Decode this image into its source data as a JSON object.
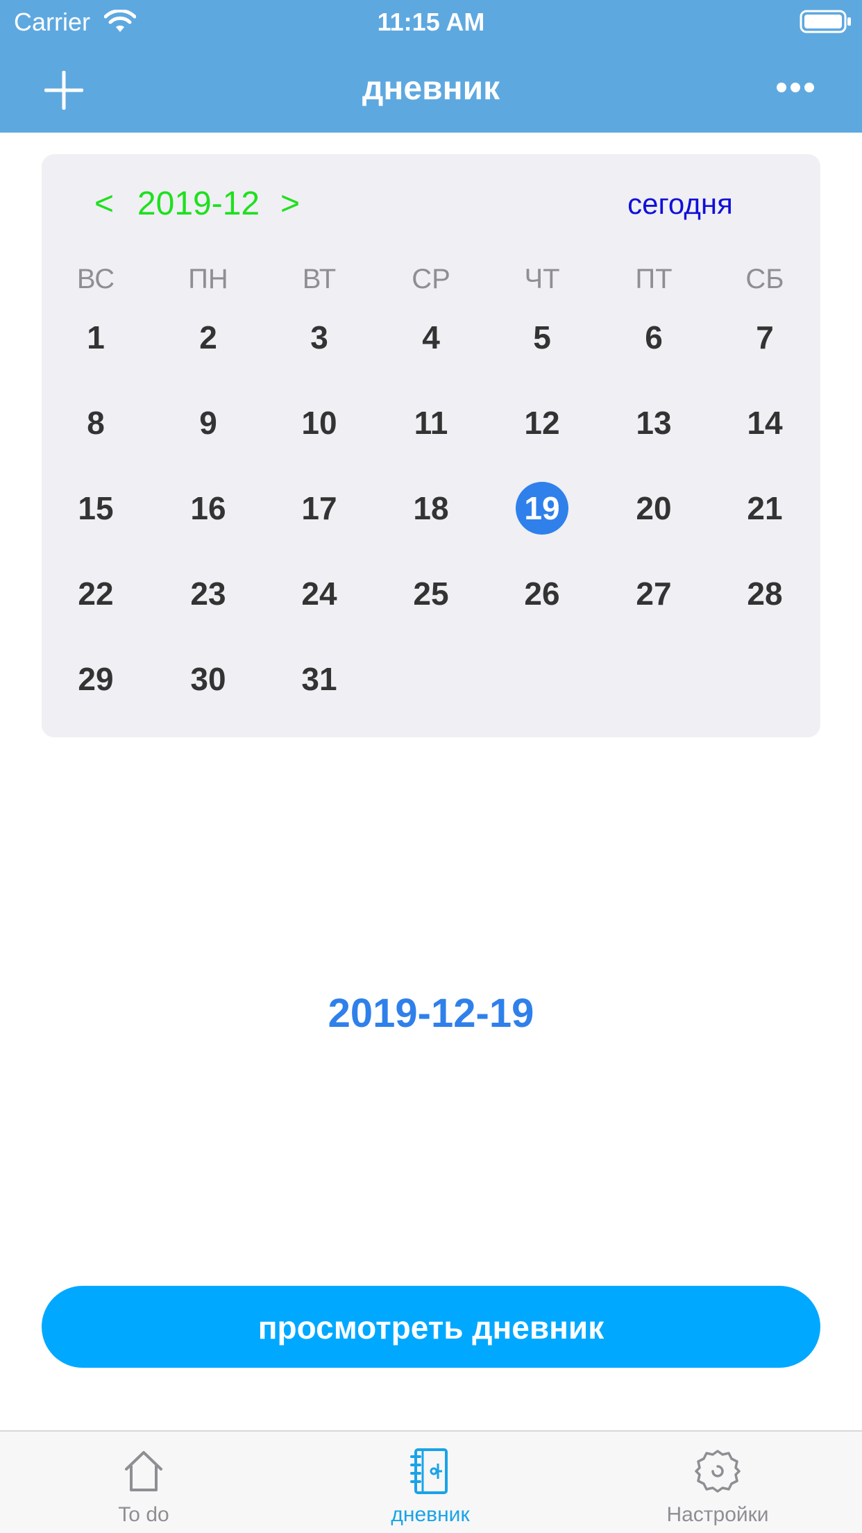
{
  "status_bar": {
    "carrier": "Carrier",
    "time": "11:15 AM",
    "wifi_icon": "wifi-icon",
    "battery_icon": "battery-icon"
  },
  "nav_bar": {
    "title": "дневник",
    "add_icon": "plus-icon",
    "more_icon": "ellipsis-icon",
    "background_color": "#5ea8e0"
  },
  "calendar": {
    "prev_label": "<",
    "month_label": "2019-12",
    "next_label": ">",
    "today_label": "сегодня",
    "weekdays": [
      "ВС",
      "ПН",
      "ВТ",
      "СР",
      "ЧТ",
      "ПТ",
      "СБ"
    ],
    "weeks": [
      [
        "1",
        "2",
        "3",
        "4",
        "5",
        "6",
        "7"
      ],
      [
        "8",
        "9",
        "10",
        "11",
        "12",
        "13",
        "14"
      ],
      [
        "15",
        "16",
        "17",
        "18",
        "19",
        "20",
        "21"
      ],
      [
        "22",
        "23",
        "24",
        "25",
        "26",
        "27",
        "28"
      ],
      [
        "29",
        "30",
        "31"
      ]
    ],
    "selected_day": "19",
    "nav_color": "#1ee01e",
    "today_color": "#1010d8",
    "selected_color": "#2f80ea"
  },
  "selected_date": "2019-12-19",
  "view_button_label": "просмотреть дневник",
  "view_button_color": "#00a8ff",
  "tab_bar": {
    "tabs": [
      {
        "label": "To do",
        "icon": "house-icon",
        "active": false
      },
      {
        "label": "дневник",
        "icon": "notebook-icon",
        "active": true
      },
      {
        "label": "Настройки",
        "icon": "gear-icon",
        "active": false
      }
    ],
    "active_color": "#1aa3e8"
  }
}
